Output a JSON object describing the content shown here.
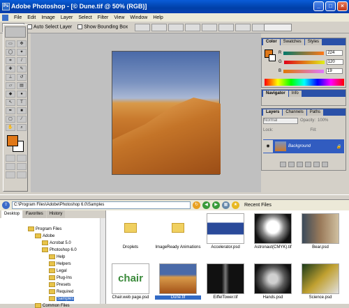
{
  "window": {
    "title": "Adobe Photoshop - [© Dune.tif @ 50% (RGB)]"
  },
  "menu": [
    "File",
    "Edit",
    "Image",
    "Layer",
    "Select",
    "Filter",
    "View",
    "Window",
    "Help"
  ],
  "options": {
    "auto_select": "Auto Select Layer",
    "bounding": "Show Bounding Box"
  },
  "color_panel": {
    "tabs": [
      "Color",
      "Swatches",
      "Styles"
    ],
    "rows": [
      {
        "label": "R",
        "value": "224",
        "gradient": "linear-gradient(90deg,#00786a,#ff7818)"
      },
      {
        "label": "G",
        "value": "120",
        "gradient": "linear-gradient(90deg,#e00018,#e0f018)"
      },
      {
        "label": "B",
        "value": "19",
        "gradient": "linear-gradient(90deg,#e07800,#e078ff)"
      }
    ]
  },
  "navigator": {
    "tabs": [
      "Navigator",
      "Info"
    ]
  },
  "layers_panel": {
    "tabs": [
      "Layers",
      "Channels",
      "Paths"
    ],
    "mode": "Normal",
    "opacity_label": "Opacity:",
    "opacity": "100%",
    "lock_label": "Lock:",
    "fill_label": "Fill:",
    "layer_name": "Background"
  },
  "browser": {
    "path": "C:\\Program Files\\Adobe\\Photoshop 6.0\\Samples",
    "recent": "Recent Files",
    "tabs": [
      "Desktop",
      "Favorites",
      "History"
    ],
    "tree": [
      {
        "label": "Program Files",
        "indent": 0
      },
      {
        "label": "Adobe",
        "indent": 1
      },
      {
        "label": "Acrobat 5.0",
        "indent": 2
      },
      {
        "label": "Photoshop 6.0",
        "indent": 2
      },
      {
        "label": "Help",
        "indent": 3
      },
      {
        "label": "Helpers",
        "indent": 3
      },
      {
        "label": "Legal",
        "indent": 3
      },
      {
        "label": "Plug-Ins",
        "indent": 3
      },
      {
        "label": "Presets",
        "indent": 3
      },
      {
        "label": "Required",
        "indent": 3
      },
      {
        "label": "Samples",
        "indent": 3
      },
      {
        "label": "Common Files",
        "indent": 1
      }
    ],
    "files": [
      {
        "name": "Droplets",
        "kind": "folder"
      },
      {
        "name": "ImageReady Animations",
        "kind": "folder"
      },
      {
        "name": "Accelerator.psd",
        "kind": "image",
        "bg": "linear-gradient(#fff 30%,#2a4a9a 30%,#2a4a9a 70%,#fff 70%)"
      },
      {
        "name": "Astronaut(CMYK).tif",
        "kind": "image",
        "bg": "radial-gradient(circle at 50% 45%,#fff 25%,#888 45%,#111 75%)"
      },
      {
        "name": "Bear.psd",
        "kind": "image",
        "bg": "linear-gradient(90deg,#3a4a5a,#9a7a5a,#d0c0a0)"
      },
      {
        "name": "Chair.web page.psd",
        "kind": "image",
        "bg": "#fff",
        "text": "chair"
      },
      {
        "name": "Dune.tif",
        "kind": "image",
        "bg": "linear-gradient(180deg,#4a6aa8 35%,#d89a4a 45%,#a35218)",
        "selected": true
      },
      {
        "name": "EiffelTower.tif",
        "kind": "image",
        "bg": "linear-gradient(90deg,#111 40%,#777 50%,#111 60%)"
      },
      {
        "name": "Hands.psd",
        "kind": "image",
        "bg": "radial-gradient(circle,#d0d0d0 20%,#5a5a5a 50%,#111 80%)"
      },
      {
        "name": "Science.psd",
        "kind": "image",
        "bg": "linear-gradient(135deg,#1a3a1a,#c0a030,#e0e0e0)"
      }
    ]
  }
}
